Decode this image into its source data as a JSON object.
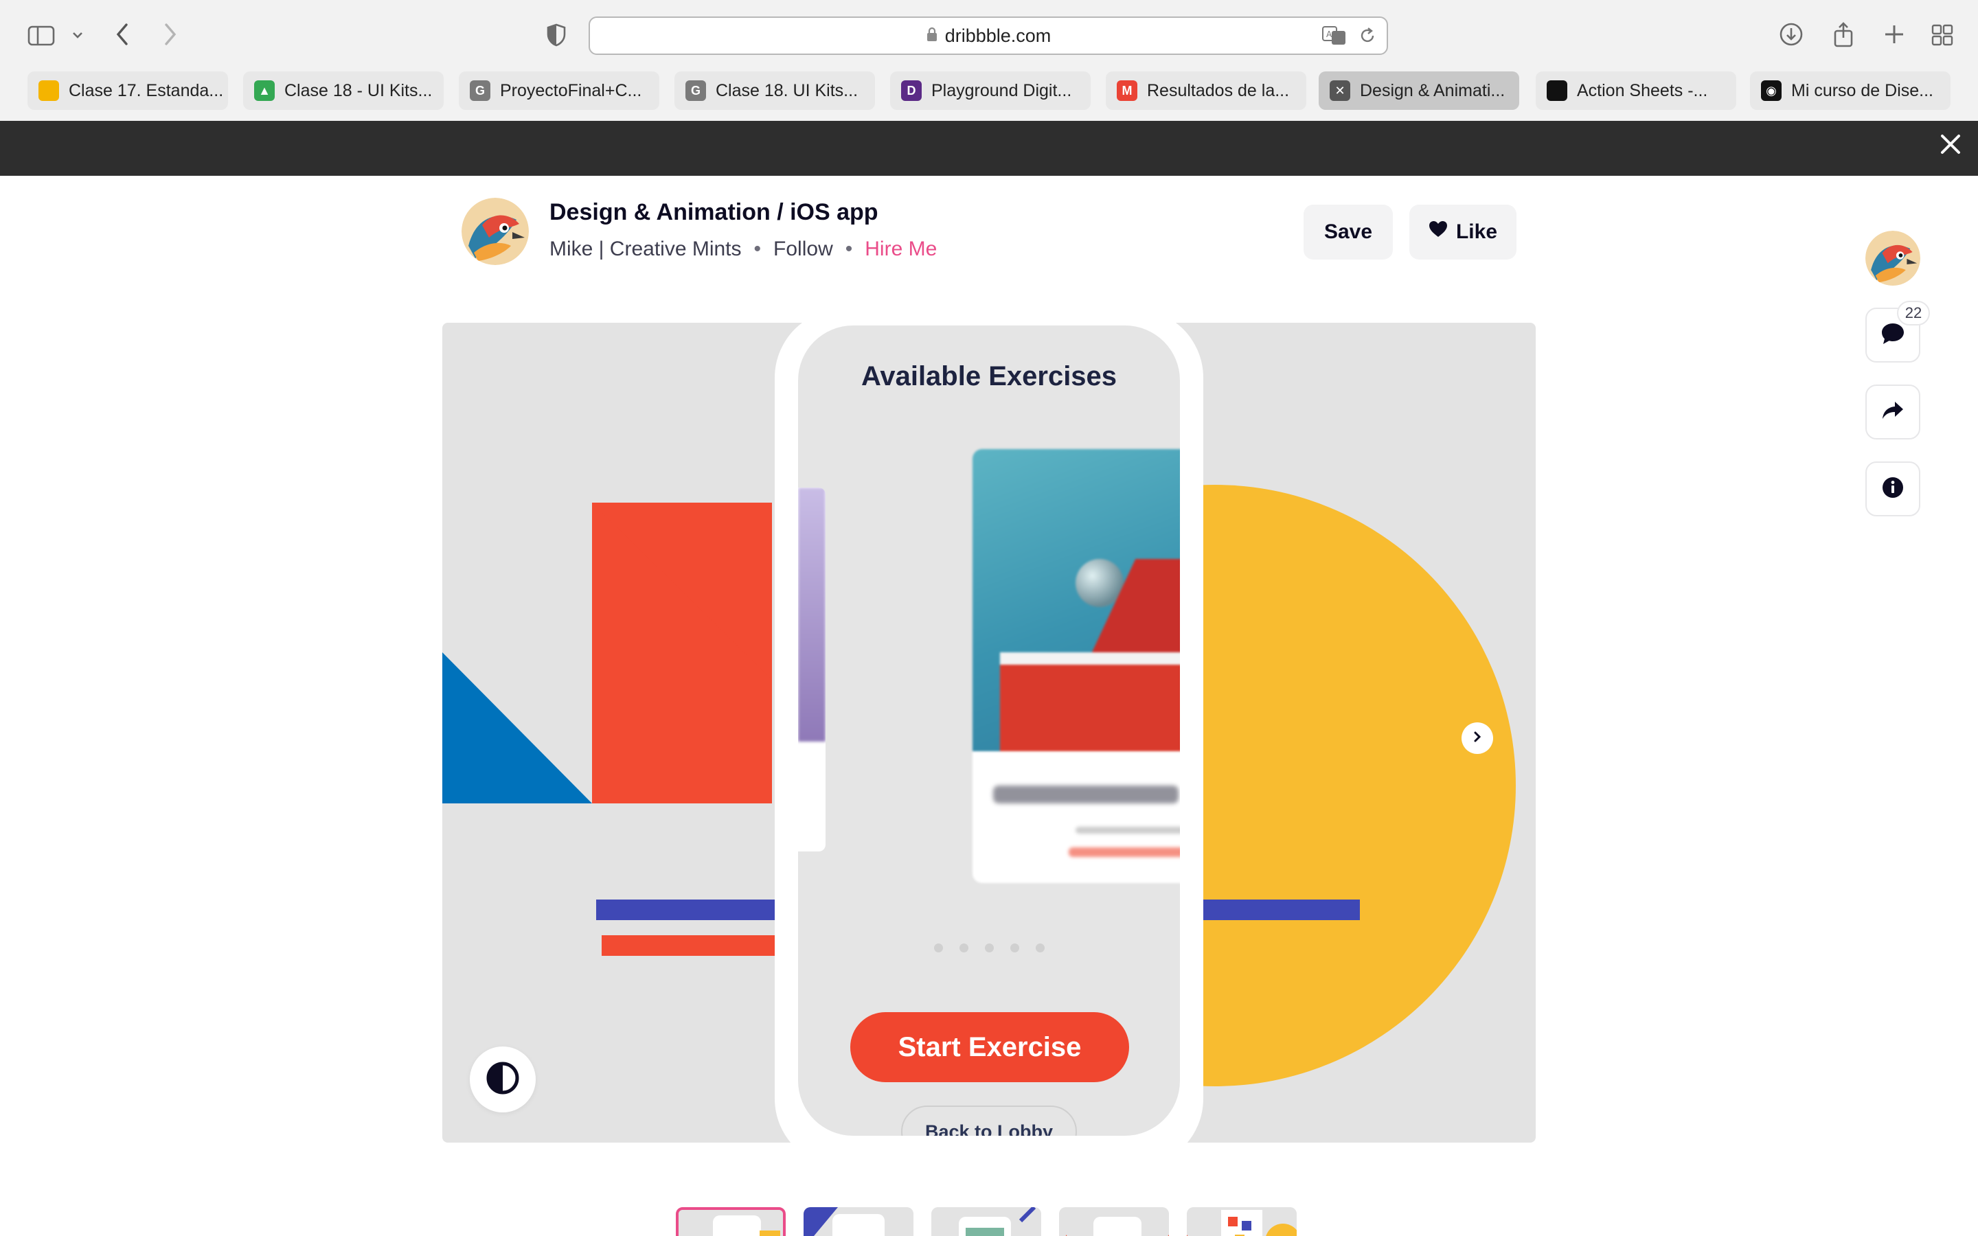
{
  "browser": {
    "url": "dribbble.com",
    "tabs": [
      {
        "label": "Clase 17. Estanda...",
        "color": "#f4b400",
        "glyph": ""
      },
      {
        "label": "Clase 18 - UI Kits...",
        "color": "#34a853",
        "glyph": "▲"
      },
      {
        "label": "ProyectoFinal+C...",
        "color": "#7a7a7a",
        "glyph": "G"
      },
      {
        "label": "Clase 18. UI Kits...",
        "color": "#7a7a7a",
        "glyph": "G"
      },
      {
        "label": "Playground Digit...",
        "color": "#5b2a86",
        "glyph": "D"
      },
      {
        "label": "Resultados de la...",
        "color": "#ea4335",
        "glyph": "M"
      },
      {
        "label": "Design & Animati...",
        "color": "#555555",
        "glyph": "✕"
      },
      {
        "label": "Action Sheets -...",
        "color": "#111111",
        "glyph": ""
      },
      {
        "label": "Mi curso de Dise...",
        "color": "#111111",
        "glyph": "◉"
      }
    ],
    "active_tab": 6
  },
  "shot": {
    "title": "Design & Animation / iOS app",
    "author": "Mike | Creative Mints",
    "sep": "•",
    "follow": "Follow",
    "hire": "Hire Me",
    "save": "Save",
    "like": "Like",
    "comment_count": "22"
  },
  "app": {
    "heading": "Available Exercises",
    "primary_button": "Start Exercise",
    "secondary_button": "Back to Lobby",
    "page_dots": 5
  },
  "thumbnails": 5,
  "colors": {
    "brand_pink": "#ea4c89",
    "accent_red": "#f0462f",
    "blue": "#0072bb",
    "yellow": "#f8bc30",
    "indigo": "#3f48b5"
  }
}
